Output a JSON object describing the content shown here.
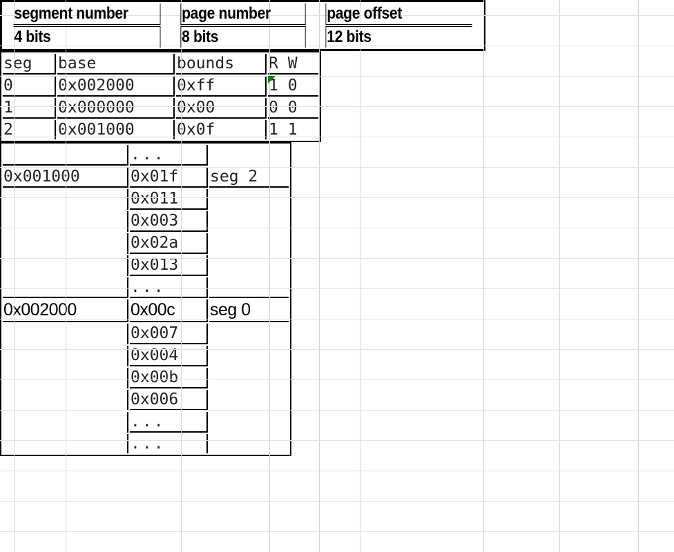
{
  "address_format": {
    "fields": [
      "segment number",
      "page number",
      "page offset"
    ],
    "widths": [
      "4 bits",
      "8 bits",
      "12 bits"
    ]
  },
  "segment_table": {
    "headers": [
      "seg",
      "base",
      "bounds",
      "R W"
    ],
    "rows": [
      {
        "seg": "0",
        "base": "0x002000",
        "bounds": "0xff",
        "rw": "1 0",
        "has_comment_marker": true
      },
      {
        "seg": "1",
        "base": "0x000000",
        "bounds": "0x00",
        "rw": "0 0",
        "has_comment_marker": false
      },
      {
        "seg": "2",
        "base": "0x001000",
        "bounds": "0x0f",
        "rw": "1 1",
        "has_comment_marker": false
      }
    ],
    "comment_marker_color": "#0f7d16"
  },
  "memory_table": {
    "rows": [
      {
        "address": "",
        "value": "...",
        "label": "",
        "font": "mono"
      },
      {
        "address": "0x001000",
        "value": "0x01f",
        "label": "seg 2",
        "font": "mono"
      },
      {
        "address": "",
        "value": "0x011",
        "label": "",
        "font": "mono"
      },
      {
        "address": "",
        "value": "0x003",
        "label": "",
        "font": "mono"
      },
      {
        "address": "",
        "value": "0x02a",
        "label": "",
        "font": "mono"
      },
      {
        "address": "",
        "value": "0x013",
        "label": "",
        "font": "mono"
      },
      {
        "address": "",
        "value": "...",
        "label": "",
        "font": "mono"
      },
      {
        "address": "0x002000",
        "value": "0x00c",
        "label": "seg 0",
        "font": "sans"
      },
      {
        "address": "",
        "value": "0x007",
        "label": "",
        "font": "mono"
      },
      {
        "address": "",
        "value": "0x004",
        "label": "",
        "font": "mono"
      },
      {
        "address": "",
        "value": "0x00b",
        "label": "",
        "font": "mono"
      },
      {
        "address": "",
        "value": "0x006",
        "label": "",
        "font": "mono"
      },
      {
        "address": "",
        "value": "...",
        "label": "",
        "font": "mono"
      },
      {
        "address": "",
        "value": "...",
        "label": "",
        "font": "mono"
      }
    ]
  }
}
